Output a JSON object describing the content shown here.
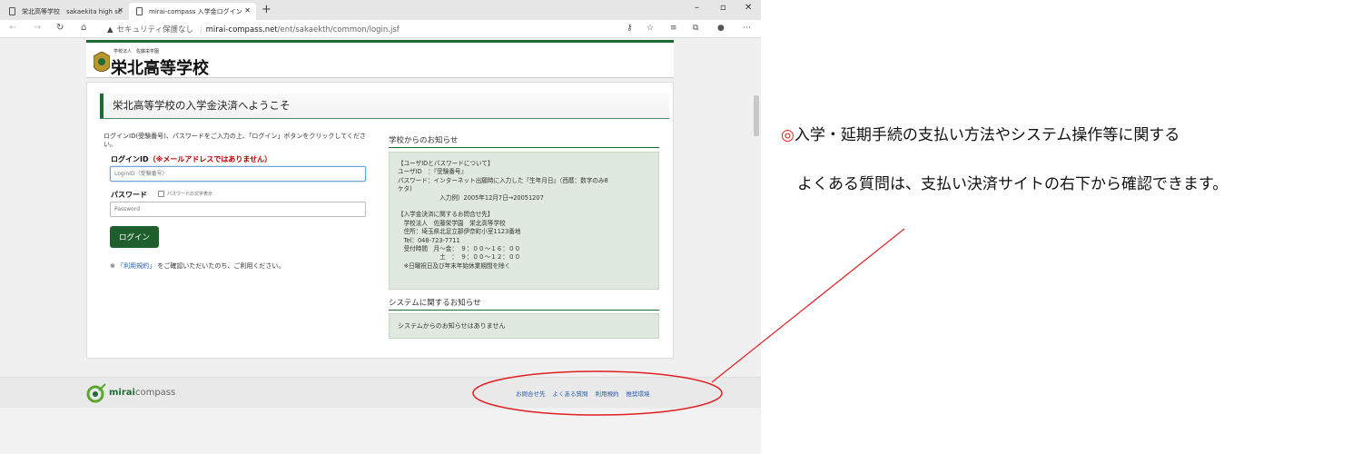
{
  "browser": {
    "tabs": [
      {
        "title": "栄北高等学校　sakaekita high sc"
      },
      {
        "title": "mirai-compass 入学金ログイン"
      }
    ],
    "new_tab": "+",
    "window_controls": {
      "minimize": "–",
      "restore": "▫",
      "close": "✕"
    },
    "nav": {
      "back": "←",
      "forward": "→",
      "reload": "↻",
      "home": "⌂"
    },
    "address": {
      "security_label": "セキュリティ保護なし",
      "host": "mirai-compass.net",
      "path": "/ent/sakaekth/common/login.jsf"
    }
  },
  "school_header": {
    "small_text": "学校法人　佐藤栄学園",
    "name": "栄北高等学校"
  },
  "login": {
    "welcome": "栄北高等学校の入学金決済へようこそ",
    "instruction": "ログインID(受験番号)、パスワードをご入力の上、「ログイン」ボタンをクリックしてください。",
    "loginid_label": "ログインID",
    "loginid_note": "（※メールアドレスではありません）",
    "loginid_placeholder": "LoginID（受験番号）",
    "password_label": "パスワード",
    "show_password_label": "パスワードの文字表示",
    "password_placeholder": "Password",
    "login_button": "ログイン",
    "terms_prefix": "※",
    "terms_link": "「利用規約」",
    "terms_suffix": "をご確認いただいたのち、ご利用ください。"
  },
  "notices": {
    "school_title": "学校からのお知らせ",
    "school_body": "【ユーザIDとパスワードについて】\nユーザID　：『受験番号』\nパスワード：インターネット出願時に入力した『生年月日』（西暦：数字のみ8\nケタ)\n　　　　　　　入力例）2005年12月7日→20051207\n\n【入学金決済に関するお問合せ先】\n　学校法人　佐藤栄学園　栄北高等学校\n　住所：埼玉県北足立郡伊奈町小室1123番地\n　Tel：048-723-7711\n　受付時間　月～金：　９：００～１６：００\n　　　　　　　土　：　９：００～１２：００\n　※日曜祝日及び年末年始休業期間を除く",
    "system_title": "システムに関するお知らせ",
    "system_body": "システムからのお知らせはありません"
  },
  "footer": {
    "brand_bold": "mirai",
    "brand_rest": "compass",
    "links": [
      "お問合せ先",
      "よくある質問",
      "利用規約",
      "推奨環境"
    ]
  },
  "annotation": {
    "mark": "◎",
    "line1": "入学・延期手続の支払い方法やシステム操作等に関する",
    "line2": "よくある質問は、支払い決済サイトの右下から確認できます。",
    "color": "#e02020"
  },
  "colors": {
    "brand_green": "#1f6b35",
    "button_green": "#1f5f2e",
    "notice_bg": "#dfe9df",
    "link_blue": "#2a5db0"
  }
}
